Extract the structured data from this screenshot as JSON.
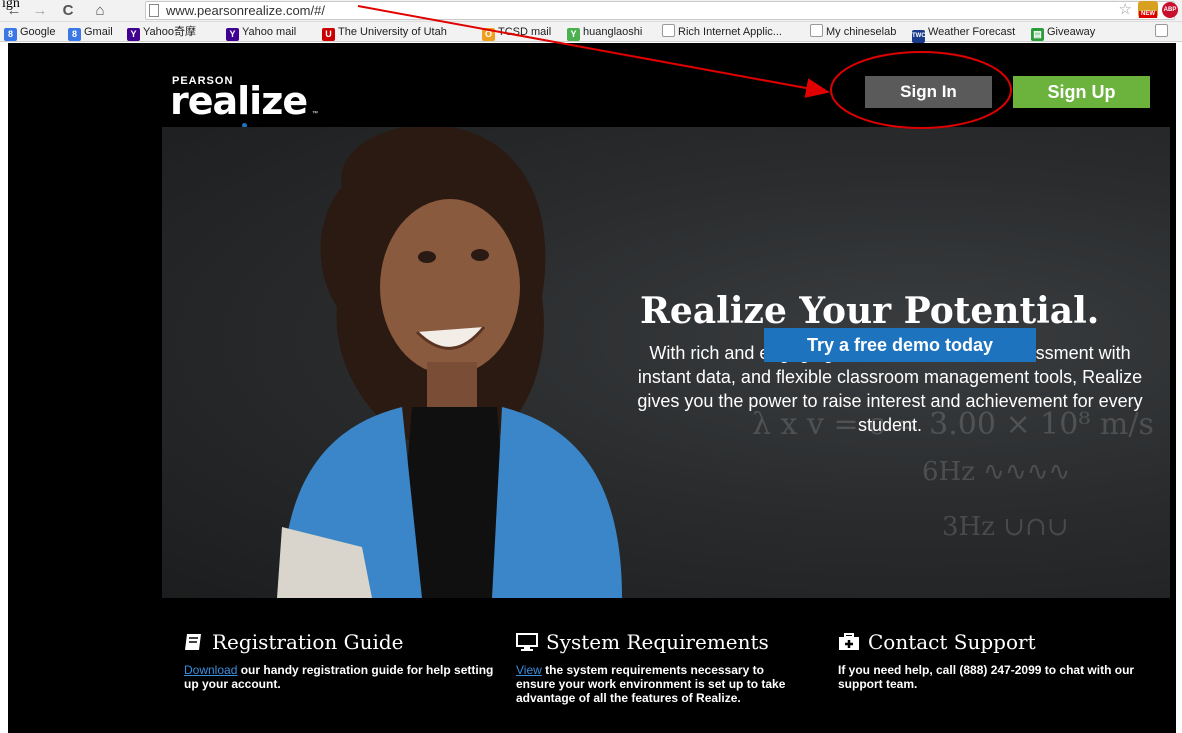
{
  "caption": "ign",
  "browser": {
    "url": "www.pearsonrealize.com/#/",
    "nav": {
      "back": "←",
      "forward": "→",
      "reload": "C",
      "home": "⌂"
    },
    "extensions": {
      "weather_badge": "NEW",
      "abp": "ABP"
    }
  },
  "bookmarks": [
    {
      "label": "Google",
      "icon": "google-icon",
      "color": "#3b78e7"
    },
    {
      "label": "Gmail",
      "icon": "google-icon",
      "color": "#3b78e7"
    },
    {
      "label": "Yahoo奇摩",
      "icon": "yahoo-icon",
      "color": "#400090"
    },
    {
      "label": "Yahoo mail",
      "icon": "yahoo-icon",
      "color": "#400090"
    },
    {
      "label": "The University of Utah",
      "icon": "utah-icon",
      "color": "#cc0000"
    },
    {
      "label": "TCSD mail",
      "icon": "outlook-icon",
      "color": "#f0a020"
    },
    {
      "label": "huanglaoshi",
      "icon": "plant-icon",
      "color": "#4caf50"
    },
    {
      "label": "Rich Internet Applic...",
      "icon": "page-icon",
      "color": "#ffffff"
    },
    {
      "label": "My chineselab",
      "icon": "page-icon",
      "color": "#ffffff"
    },
    {
      "label": "Weather Forecast",
      "icon": "twc-icon",
      "color": "#1a3a8c"
    },
    {
      "label": "Giveaway",
      "icon": "gift-icon",
      "color": "#2a9d3a"
    }
  ],
  "header": {
    "logo_small": "PEARSON",
    "logo_main": "realize",
    "logo_tm": "™",
    "sign_in": "Sign In",
    "sign_up": "Sign Up",
    "sign_in_color": "#5a5a5a",
    "sign_up_color": "#6cb33e"
  },
  "hero": {
    "title": "Realize Your Potential.",
    "text": "With rich and engaging content, embedded assessment with instant data, and flexible classroom management tools, Realize gives you the power to raise interest and achievement for every student.",
    "demo_button": "Try a free demo today",
    "demo_color": "#1e73be"
  },
  "features": [
    {
      "icon": "book-icon",
      "title": "Registration Guide",
      "link": "Download",
      "body": " our handy registration guide for help setting up your account."
    },
    {
      "icon": "monitor-icon",
      "title": "System Requirements",
      "link": "View",
      "body": " the system requirements necessary to ensure your work environment is set up to take advantage of all the features of Realize."
    },
    {
      "icon": "medkit-icon",
      "title": "Contact Support",
      "link": "",
      "body": "If you need help, call (888) 247-2099 to chat with our support team."
    }
  ],
  "annotation_color": "#e00000"
}
